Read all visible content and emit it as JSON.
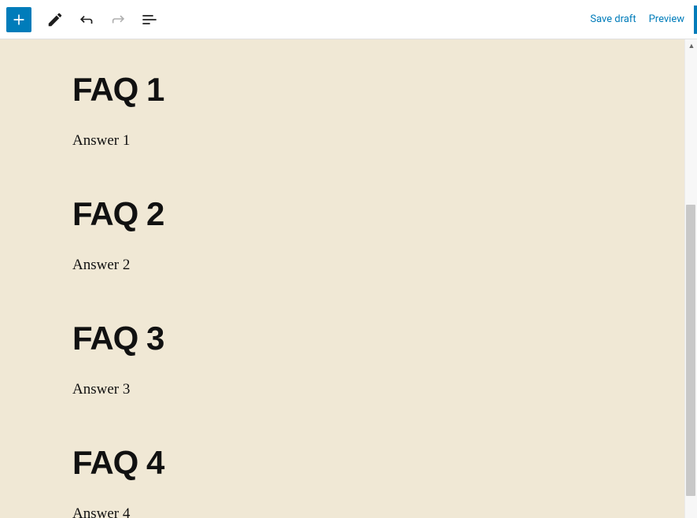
{
  "toolbar": {
    "save_draft": "Save draft",
    "preview": "Preview"
  },
  "content": {
    "faqs": [
      {
        "heading": "FAQ 1",
        "answer": "Answer 1"
      },
      {
        "heading": "FAQ 2",
        "answer": "Answer 2"
      },
      {
        "heading": "FAQ 3",
        "answer": "Answer 3"
      },
      {
        "heading": "FAQ 4",
        "answer": "Answer 4"
      }
    ]
  }
}
